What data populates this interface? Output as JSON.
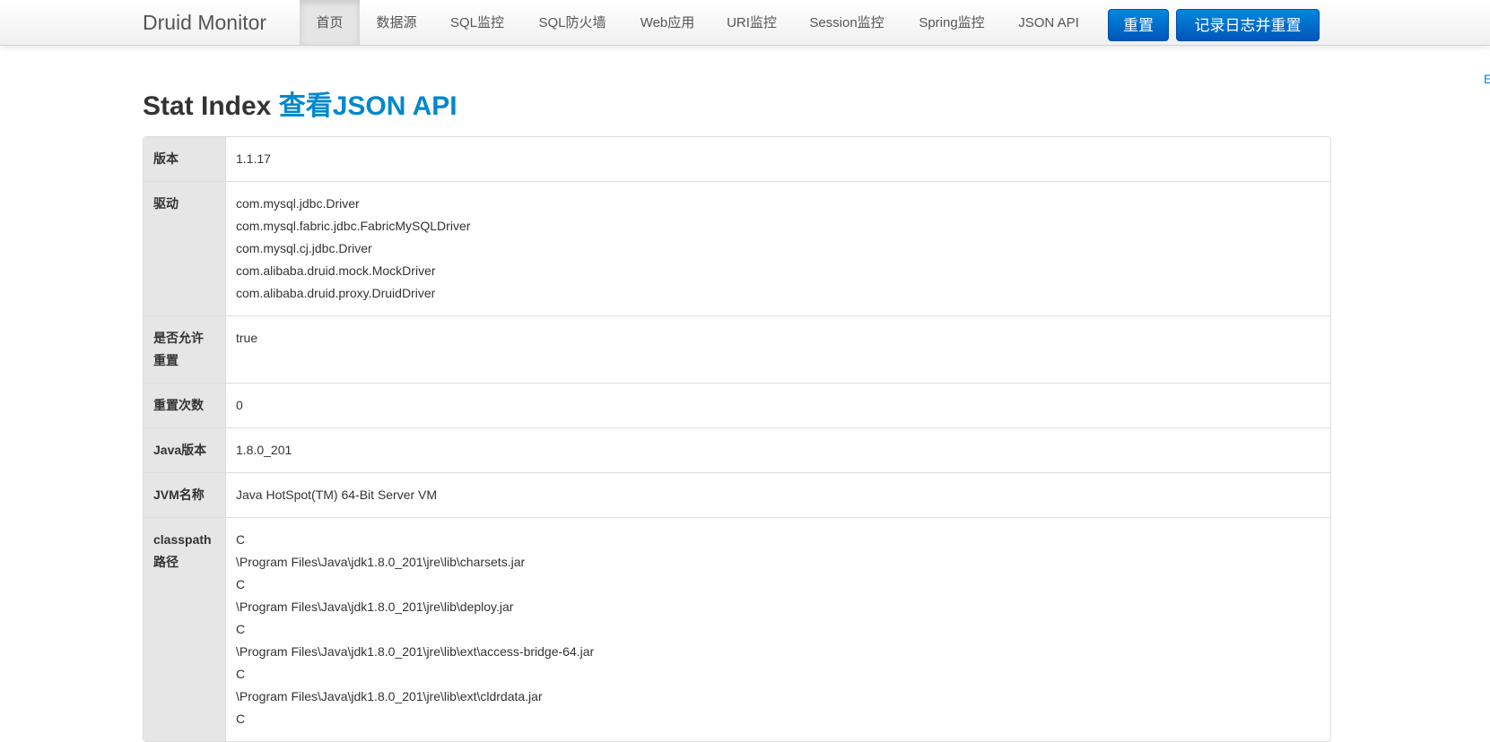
{
  "navbar": {
    "brand": "Druid Monitor",
    "items": [
      {
        "label": "首页",
        "active": true
      },
      {
        "label": "数据源"
      },
      {
        "label": "SQL监控"
      },
      {
        "label": "SQL防火墙"
      },
      {
        "label": "Web应用"
      },
      {
        "label": "URI监控"
      },
      {
        "label": "Session监控"
      },
      {
        "label": "Spring监控"
      },
      {
        "label": "JSON API"
      }
    ],
    "reset_button": "重置",
    "log_reset_button": "记录日志并重置"
  },
  "side_link": "E",
  "title": {
    "text": "Stat Index",
    "link": "查看JSON API"
  },
  "rows": [
    {
      "label": "版本",
      "values": [
        "1.1.17"
      ]
    },
    {
      "label": "驱动",
      "values": [
        "com.mysql.jdbc.Driver",
        "com.mysql.fabric.jdbc.FabricMySQLDriver",
        "com.mysql.cj.jdbc.Driver",
        "com.alibaba.druid.mock.MockDriver",
        "com.alibaba.druid.proxy.DruidDriver"
      ]
    },
    {
      "label_lines": [
        "是否允许",
        "重置"
      ],
      "values": [
        "true"
      ]
    },
    {
      "label": "重置次数",
      "values": [
        "0"
      ]
    },
    {
      "label": "Java版本",
      "values": [
        "1.8.0_201"
      ]
    },
    {
      "label": "JVM名称",
      "values": [
        "Java HotSpot(TM) 64-Bit Server VM"
      ]
    },
    {
      "label_lines": [
        "classpath",
        "路径"
      ],
      "values": [
        "C",
        "\\Program Files\\Java\\jdk1.8.0_201\\jre\\lib\\charsets.jar",
        "C",
        "\\Program Files\\Java\\jdk1.8.0_201\\jre\\lib\\deploy.jar",
        "C",
        "\\Program Files\\Java\\jdk1.8.0_201\\jre\\lib\\ext\\access-bridge-64.jar",
        "C",
        "\\Program Files\\Java\\jdk1.8.0_201\\jre\\lib\\ext\\cldrdata.jar",
        "C"
      ]
    }
  ]
}
